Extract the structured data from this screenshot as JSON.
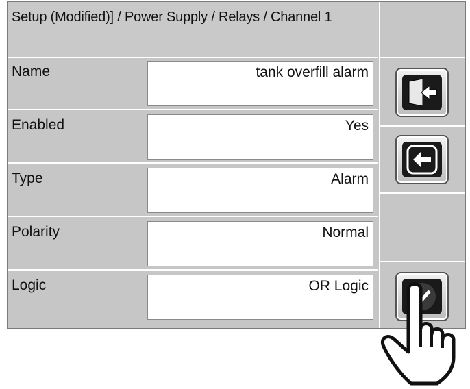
{
  "breadcrumb": "Setup (Modified)] / Power Supply / Relays / Channel 1",
  "rows": [
    {
      "label": "Name",
      "value": "tank overfill alarm"
    },
    {
      "label": "Enabled",
      "value": "Yes"
    },
    {
      "label": "Type",
      "value": "Alarm"
    },
    {
      "label": "Polarity",
      "value": "Normal"
    },
    {
      "label": "Logic",
      "value": "OR Logic"
    }
  ],
  "icons": {
    "exit": "exit-door-icon",
    "back": "back-arrow-icon",
    "accept": "checkmark-icon",
    "pointer": "pointing-hand-icon"
  }
}
